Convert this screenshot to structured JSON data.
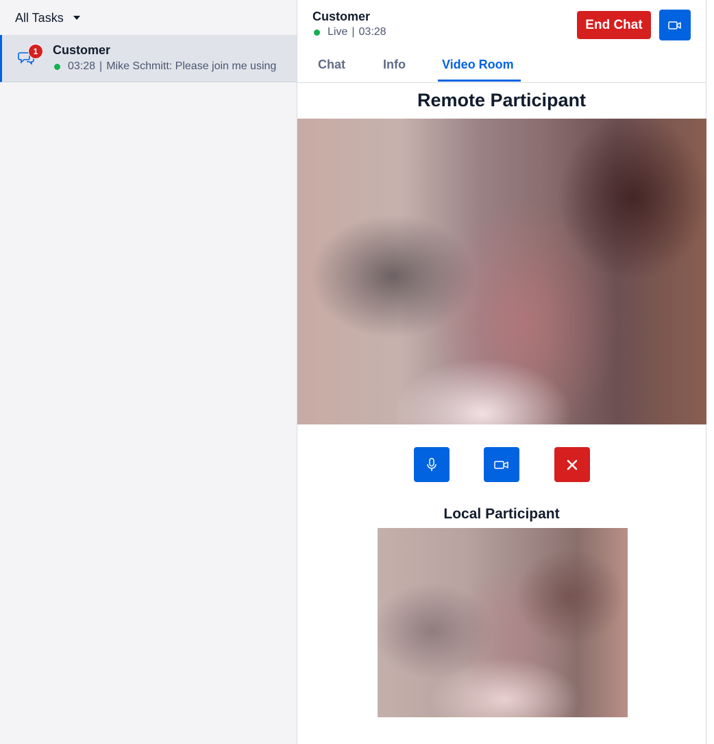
{
  "sidebar": {
    "filter_label": "All Tasks",
    "tasks": [
      {
        "title": "Customer",
        "badge": "1",
        "time": "03:28",
        "preview": "Mike Schmitt: Please join me using"
      }
    ]
  },
  "header": {
    "title": "Customer",
    "status": "Live",
    "timer": "03:28",
    "end_chat_label": "End Chat"
  },
  "tabs": [
    {
      "label": "Chat"
    },
    {
      "label": "Info"
    },
    {
      "label": "Video Room",
      "active": true
    }
  ],
  "video": {
    "remote_title": "Remote Participant",
    "local_title": "Local Participant"
  },
  "colors": {
    "accent_blue": "#0263e0",
    "danger_red": "#d61f1f",
    "live_green": "#14b053"
  }
}
